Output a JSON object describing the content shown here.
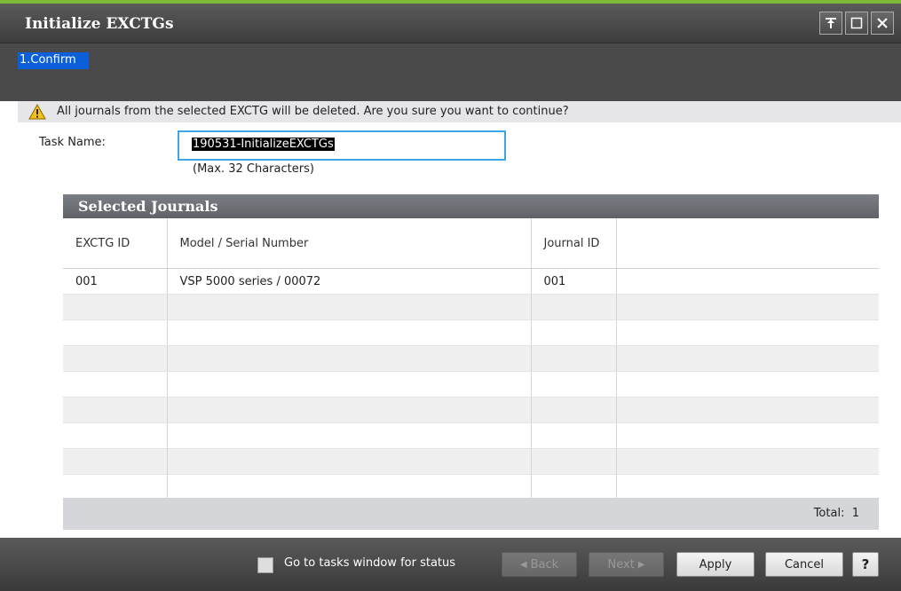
{
  "window": {
    "title": "Initialize EXCTGs"
  },
  "steps": [
    {
      "label": "1.Confirm",
      "active": true
    }
  ],
  "warning": {
    "icon": "warning-icon",
    "text": "All journals from the selected EXCTG will be deleted. Are you sure you want to continue?"
  },
  "task": {
    "label": "Task Name:",
    "value": "190531-InitializeEXCTGs",
    "note": "(Max. 32 Characters)"
  },
  "panel": {
    "title": "Selected Journals",
    "columns": [
      "EXCTG ID",
      "Model / Serial Number",
      "Journal ID",
      ""
    ],
    "rows": [
      [
        "001",
        "VSP 5000 series / 00072",
        "001",
        ""
      ]
    ],
    "total_label": "Total:",
    "total_value": "1"
  },
  "footer": {
    "checkbox_label": "Go to tasks window for status",
    "back": "Back",
    "next": "Next",
    "apply": "Apply",
    "cancel": "Cancel",
    "help": "?"
  },
  "colors": {
    "accent": "#0b5fd8",
    "focus": "#3ca5e8",
    "title_strip": "#7dba3a"
  }
}
